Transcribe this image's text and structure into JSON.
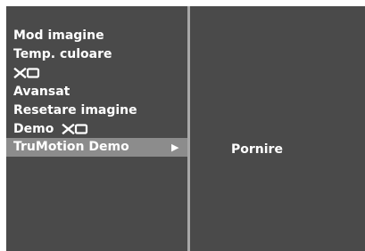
{
  "menu": {
    "items": [
      {
        "label": "Mod imagine"
      },
      {
        "label": "Temp. culoare"
      },
      {
        "label": "",
        "logo": "XD"
      },
      {
        "label": "Avansat"
      },
      {
        "label": "Resetare imagine"
      },
      {
        "label": "Demo",
        "logo": "XD"
      },
      {
        "label": "TruMotion Demo",
        "selected": true,
        "icon": "right-triangle-arrow"
      }
    ]
  },
  "submenu": {
    "items": [
      {
        "label": "Pornire"
      }
    ]
  },
  "colors": {
    "panel": "#4a4a4a",
    "highlight": "#8c8c8c",
    "divider": "#a8a8a8",
    "text": "#ffffff"
  }
}
